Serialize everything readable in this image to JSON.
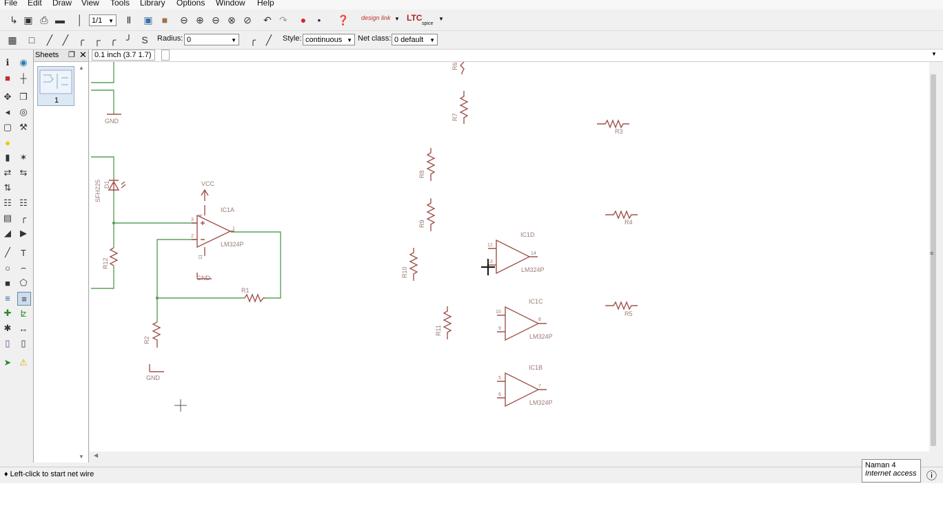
{
  "menu": [
    "File",
    "Edit",
    "Draw",
    "View",
    "Tools",
    "Library",
    "Options",
    "Window",
    "Help"
  ],
  "toolbar": {
    "sheet_select": "1/1",
    "designlink_label": "design link",
    "ltc_label": "LTC",
    "ltc_sub": "spice"
  },
  "toolbar2": {
    "radius_label": "Radius:",
    "radius_value": "0",
    "style_label": "Style:",
    "style_value": "continuous",
    "netclass_label": "Net class:",
    "netclass_value": "0 default"
  },
  "sheets": {
    "title": "Sheets",
    "pin_icon": "pin-icon",
    "close_icon": "close-icon",
    "items": [
      {
        "number": "1"
      }
    ]
  },
  "command": {
    "grid_info": "0.1 inch (3.7 1.7)",
    "input_value": ""
  },
  "status": {
    "message": "♦ Left-click to start net wire"
  },
  "tooltip": {
    "name": "Naman  4",
    "sub": "Internet access"
  },
  "colors": {
    "wire": "#5aa05a",
    "symbol": "#a0524c",
    "label": "#9a7a76"
  },
  "schematic": {
    "gnd1": "GND",
    "gnd2": "GND",
    "gnd3": "GND",
    "vcc": "VCC",
    "d_name": "SFH225",
    "d_ref": "D1",
    "ic1a_name": "IC1A",
    "ic1a_part": "LM324P",
    "ic1a_pin3": "3",
    "ic1a_pin2": "2",
    "ic1a_pin1": "1",
    "ic1a_pin4": "4",
    "ic1a_pin11": "11",
    "ic1d_name": "IC1D",
    "ic1d_part": "LM324P",
    "ic1d_pin12": "12",
    "ic1d_pin13": "13",
    "ic1d_pin14": "14",
    "ic1c_name": "IC1C",
    "ic1c_part": "LM324P",
    "ic1c_pin10": "10",
    "ic1c_pin9": "9",
    "ic1c_pin8": "8",
    "ic1b_name": "IC1B",
    "ic1b_part": "LM324P",
    "ic1b_pin5": "5",
    "ic1b_pin6": "6",
    "ic1b_pin7": "7",
    "r1": "R1",
    "r2": "R2",
    "r3": "R3",
    "r4": "R4",
    "r5": "R5",
    "r6": "R6",
    "r7": "R7",
    "r8": "R8",
    "r9": "R9",
    "r10": "R10",
    "r11": "R11",
    "r12": "R12"
  }
}
